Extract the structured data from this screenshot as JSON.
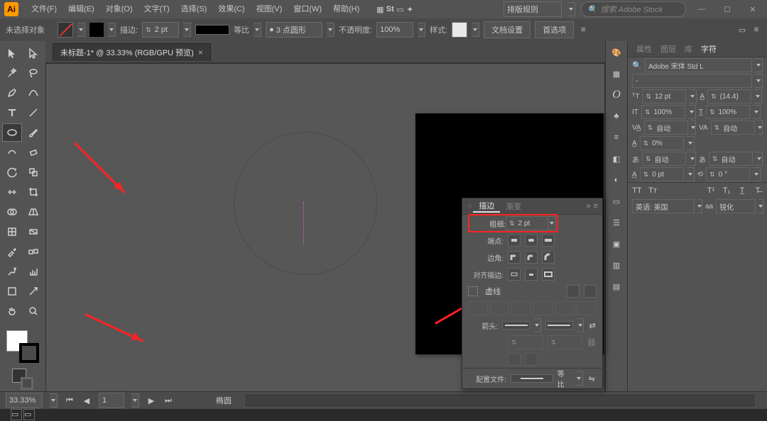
{
  "menubar": {
    "items": [
      "文件(F)",
      "编辑(E)",
      "对象(O)",
      "文字(T)",
      "选择(S)",
      "效果(C)",
      "视图(V)",
      "窗口(W)",
      "帮助(H)"
    ],
    "workspace_label": "排版规则",
    "search_placeholder": "搜索 Adobe Stock"
  },
  "options": {
    "state": "未选择对象",
    "stroke_label": "描边:",
    "stroke_val": "2 pt",
    "profile_label": "等比",
    "brush_val": "3 点圆形",
    "opacity_label": "不透明度:",
    "opacity_val": "100%",
    "style_label": "样式:",
    "doc_setup": "文档设置",
    "prefs": "首选项"
  },
  "tab": {
    "title": "未标题-1* @ 33.33% (RGB/GPU 预览)"
  },
  "stroke_panel": {
    "tab1": "描边",
    "tab2": "渐变",
    "weight_label": "粗细:",
    "weight_val": "2 pt",
    "cap_label": "端点:",
    "corner_label": "边角:",
    "align_label": "对齐描边:",
    "dashed": "虚线",
    "arrow_label": "箭头:",
    "profile_label": "配置文件:",
    "profile_val": "等比"
  },
  "char": {
    "tabs": [
      "属性",
      "图层",
      "库",
      "字符"
    ],
    "font": "Adobe 宋体 Std L",
    "size": "12 pt",
    "leading": "(14.4)",
    "hscale": "100%",
    "vscale": "100%",
    "kern": "自动",
    "track": "自动",
    "baseline": "0%",
    "rotate": "自动",
    "aki": "0 pt",
    "aki2": "0",
    "lang_label": "英语: 美国",
    "aa_label": "锐化"
  },
  "status": {
    "zoom": "33.33%",
    "tool": "椭圆"
  }
}
